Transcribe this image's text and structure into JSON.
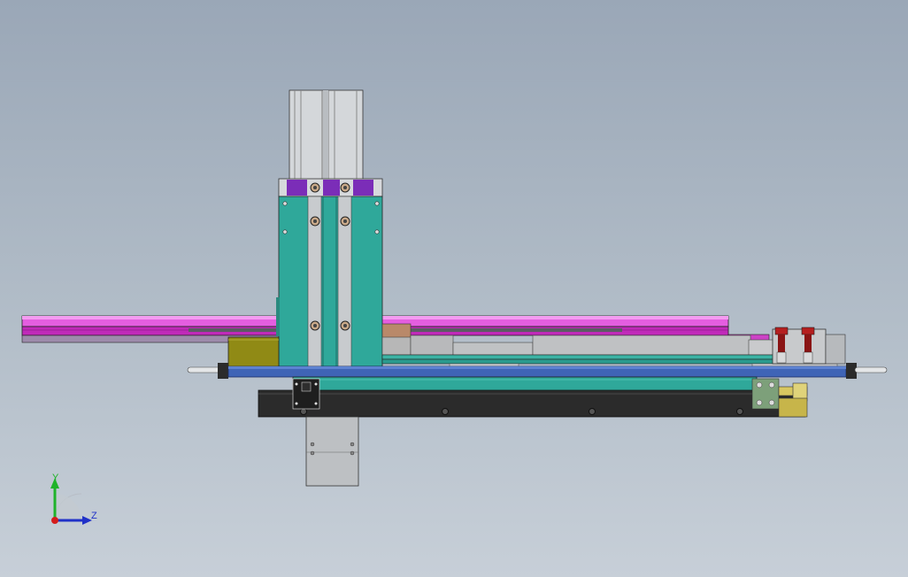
{
  "viewport": {
    "background_top": "#9aa7b7",
    "background_bottom": "#c7cfd8"
  },
  "colors": {
    "teal": "#2fa89a",
    "magenta": "#d62fd0",
    "blue_bar": "#3f64b6",
    "dark_base": "#2b2b2b",
    "olive": "#8f8a13",
    "purple": "#7a2fb5",
    "grey_metal": "#c4c7ca",
    "tan": "#b98a66",
    "brass": "#c0b04a",
    "red": "#b81e1e"
  },
  "triad": {
    "y_label": "Y",
    "z_label": "Z",
    "y_color": "#1fb32a",
    "z_color": "#2031c8",
    "x_color": "#d41d1d"
  }
}
